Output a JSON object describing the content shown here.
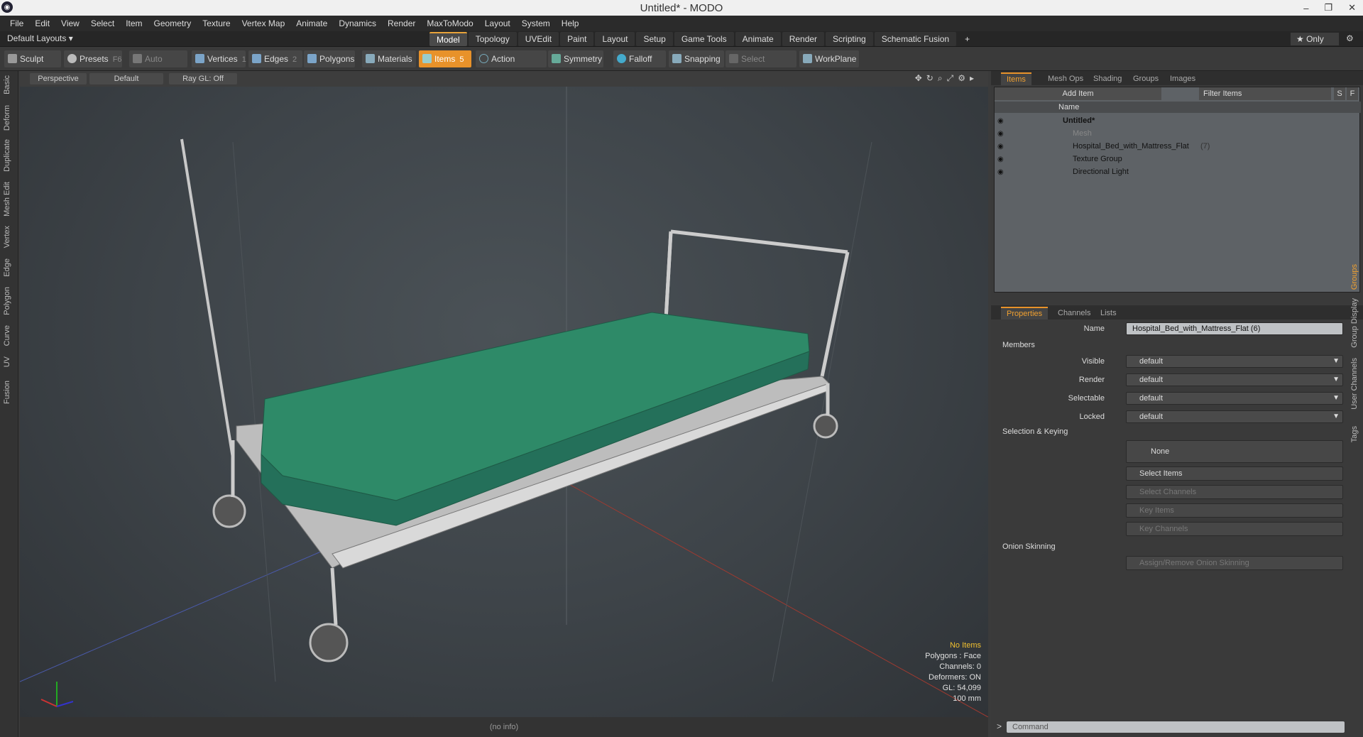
{
  "window": {
    "title": "Untitled* - MODO",
    "logo": "modo-logo",
    "min": "–",
    "restore": "❐",
    "close": "✕"
  },
  "menu": [
    "File",
    "Edit",
    "View",
    "Select",
    "Item",
    "Geometry",
    "Texture",
    "Vertex Map",
    "Animate",
    "Dynamics",
    "Render",
    "MaxToModo",
    "Layout",
    "System",
    "Help"
  ],
  "layoutbar": {
    "layout": "Default Layouts ▾",
    "tabs": [
      "Model",
      "Topology",
      "UVEdit",
      "Paint",
      "Layout",
      "Setup",
      "Game Tools",
      "Animate",
      "Render",
      "Scripting",
      "Schematic Fusion"
    ],
    "active_tab": "Model",
    "add": "+",
    "only": "★  Only"
  },
  "toolbar": {
    "sculpt": "Sculpt",
    "presets": "Presets",
    "presets_key": "F6",
    "auto_select": "Auto Select",
    "vertices": "Vertices",
    "vertices_n": "1",
    "edges": "Edges",
    "edges_n": "2",
    "polygons": "Polygons",
    "materials": "Materials",
    "items": "Items",
    "items_n": "5",
    "action_center": "Action Center",
    "symmetry": "Symmetry",
    "falloff": "Falloff",
    "snapping": "Snapping",
    "select_through": "Select Through",
    "workplane": "WorkPlane"
  },
  "lefttabs": [
    "Basic",
    "Deform",
    "Duplicate",
    "Mesh Edit",
    "Vertex",
    "Edge",
    "Polygon",
    "Curve",
    "UV",
    "Fusion"
  ],
  "viewport": {
    "view": "Perspective",
    "shading": "Default",
    "raygl": "Ray GL: Off",
    "stats": {
      "selection": "No Items",
      "polygons": "Polygons : Face",
      "channels": "Channels: 0",
      "deformers": "Deformers: ON",
      "gl": "GL: 54,099",
      "unit": "100 mm"
    },
    "status": "(no info)",
    "mattress_color": "#2e8a68"
  },
  "items_panel": {
    "tabs": [
      "Items",
      "Mesh Ops",
      "Shading",
      "Groups",
      "Images"
    ],
    "active": "Items",
    "add_item": "Add Item",
    "filter": "Filter Items",
    "s": "S",
    "f": "F",
    "col_name": "Name",
    "rows": [
      {
        "name": "Untitled*",
        "level": 0,
        "bold": true
      },
      {
        "name": "Mesh",
        "level": 1,
        "dim": true
      },
      {
        "name": "Hospital_Bed_with_Mattress_Flat",
        "count": "(7)",
        "level": 1
      },
      {
        "name": "Texture Group",
        "level": 1
      },
      {
        "name": "Directional Light",
        "level": 1
      }
    ]
  },
  "props_panel": {
    "tabs": [
      "Properties",
      "Channels",
      "Lists"
    ],
    "active": "Properties",
    "name_label": "Name",
    "name_value": "Hospital_Bed_with_Mattress_Flat (6)",
    "members": "Members",
    "fields": [
      {
        "label": "Visible",
        "value": "default"
      },
      {
        "label": "Render",
        "value": "default"
      },
      {
        "label": "Selectable",
        "value": "default"
      },
      {
        "label": "Locked",
        "value": "default"
      }
    ],
    "sel_keying": "Selection & Keying",
    "none": "None",
    "select_items": "Select Items",
    "select_channels": "Select Channels",
    "key_items": "Key Items",
    "key_channels": "Key Channels",
    "onion": "Onion Skinning",
    "assign_onion": "Assign/Remove Onion Skinning",
    "side_tabs": [
      "Groups",
      "Group Display",
      "User Channels",
      "Tags"
    ]
  },
  "command": {
    "prompt": ">",
    "placeholder": "Command"
  }
}
